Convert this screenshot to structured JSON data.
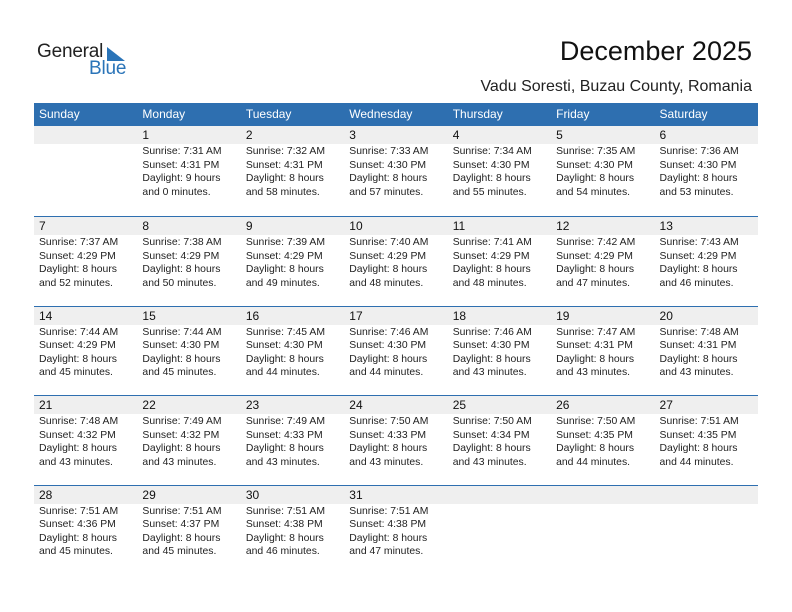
{
  "logo": {
    "general": "General",
    "blue": "Blue"
  },
  "header": {
    "title": "December 2025",
    "location": "Vadu Soresti, Buzau County, Romania"
  },
  "colors": {
    "accent": "#2e6fb0",
    "date_row_bg": "#efefef"
  },
  "weekdays": [
    "Sunday",
    "Monday",
    "Tuesday",
    "Wednesday",
    "Thursday",
    "Friday",
    "Saturday"
  ],
  "weeks": [
    [
      {
        "day": "",
        "sunrise": "",
        "sunset": "",
        "daylight1": "",
        "daylight2": ""
      },
      {
        "day": "1",
        "sunrise": "Sunrise: 7:31 AM",
        "sunset": "Sunset: 4:31 PM",
        "daylight1": "Daylight: 9 hours",
        "daylight2": "and 0 minutes."
      },
      {
        "day": "2",
        "sunrise": "Sunrise: 7:32 AM",
        "sunset": "Sunset: 4:31 PM",
        "daylight1": "Daylight: 8 hours",
        "daylight2": "and 58 minutes."
      },
      {
        "day": "3",
        "sunrise": "Sunrise: 7:33 AM",
        "sunset": "Sunset: 4:30 PM",
        "daylight1": "Daylight: 8 hours",
        "daylight2": "and 57 minutes."
      },
      {
        "day": "4",
        "sunrise": "Sunrise: 7:34 AM",
        "sunset": "Sunset: 4:30 PM",
        "daylight1": "Daylight: 8 hours",
        "daylight2": "and 55 minutes."
      },
      {
        "day": "5",
        "sunrise": "Sunrise: 7:35 AM",
        "sunset": "Sunset: 4:30 PM",
        "daylight1": "Daylight: 8 hours",
        "daylight2": "and 54 minutes."
      },
      {
        "day": "6",
        "sunrise": "Sunrise: 7:36 AM",
        "sunset": "Sunset: 4:30 PM",
        "daylight1": "Daylight: 8 hours",
        "daylight2": "and 53 minutes."
      }
    ],
    [
      {
        "day": "7",
        "sunrise": "Sunrise: 7:37 AM",
        "sunset": "Sunset: 4:29 PM",
        "daylight1": "Daylight: 8 hours",
        "daylight2": "and 52 minutes."
      },
      {
        "day": "8",
        "sunrise": "Sunrise: 7:38 AM",
        "sunset": "Sunset: 4:29 PM",
        "daylight1": "Daylight: 8 hours",
        "daylight2": "and 50 minutes."
      },
      {
        "day": "9",
        "sunrise": "Sunrise: 7:39 AM",
        "sunset": "Sunset: 4:29 PM",
        "daylight1": "Daylight: 8 hours",
        "daylight2": "and 49 minutes."
      },
      {
        "day": "10",
        "sunrise": "Sunrise: 7:40 AM",
        "sunset": "Sunset: 4:29 PM",
        "daylight1": "Daylight: 8 hours",
        "daylight2": "and 48 minutes."
      },
      {
        "day": "11",
        "sunrise": "Sunrise: 7:41 AM",
        "sunset": "Sunset: 4:29 PM",
        "daylight1": "Daylight: 8 hours",
        "daylight2": "and 48 minutes."
      },
      {
        "day": "12",
        "sunrise": "Sunrise: 7:42 AM",
        "sunset": "Sunset: 4:29 PM",
        "daylight1": "Daylight: 8 hours",
        "daylight2": "and 47 minutes."
      },
      {
        "day": "13",
        "sunrise": "Sunrise: 7:43 AM",
        "sunset": "Sunset: 4:29 PM",
        "daylight1": "Daylight: 8 hours",
        "daylight2": "and 46 minutes."
      }
    ],
    [
      {
        "day": "14",
        "sunrise": "Sunrise: 7:44 AM",
        "sunset": "Sunset: 4:29 PM",
        "daylight1": "Daylight: 8 hours",
        "daylight2": "and 45 minutes."
      },
      {
        "day": "15",
        "sunrise": "Sunrise: 7:44 AM",
        "sunset": "Sunset: 4:30 PM",
        "daylight1": "Daylight: 8 hours",
        "daylight2": "and 45 minutes."
      },
      {
        "day": "16",
        "sunrise": "Sunrise: 7:45 AM",
        "sunset": "Sunset: 4:30 PM",
        "daylight1": "Daylight: 8 hours",
        "daylight2": "and 44 minutes."
      },
      {
        "day": "17",
        "sunrise": "Sunrise: 7:46 AM",
        "sunset": "Sunset: 4:30 PM",
        "daylight1": "Daylight: 8 hours",
        "daylight2": "and 44 minutes."
      },
      {
        "day": "18",
        "sunrise": "Sunrise: 7:46 AM",
        "sunset": "Sunset: 4:30 PM",
        "daylight1": "Daylight: 8 hours",
        "daylight2": "and 43 minutes."
      },
      {
        "day": "19",
        "sunrise": "Sunrise: 7:47 AM",
        "sunset": "Sunset: 4:31 PM",
        "daylight1": "Daylight: 8 hours",
        "daylight2": "and 43 minutes."
      },
      {
        "day": "20",
        "sunrise": "Sunrise: 7:48 AM",
        "sunset": "Sunset: 4:31 PM",
        "daylight1": "Daylight: 8 hours",
        "daylight2": "and 43 minutes."
      }
    ],
    [
      {
        "day": "21",
        "sunrise": "Sunrise: 7:48 AM",
        "sunset": "Sunset: 4:32 PM",
        "daylight1": "Daylight: 8 hours",
        "daylight2": "and 43 minutes."
      },
      {
        "day": "22",
        "sunrise": "Sunrise: 7:49 AM",
        "sunset": "Sunset: 4:32 PM",
        "daylight1": "Daylight: 8 hours",
        "daylight2": "and 43 minutes."
      },
      {
        "day": "23",
        "sunrise": "Sunrise: 7:49 AM",
        "sunset": "Sunset: 4:33 PM",
        "daylight1": "Daylight: 8 hours",
        "daylight2": "and 43 minutes."
      },
      {
        "day": "24",
        "sunrise": "Sunrise: 7:50 AM",
        "sunset": "Sunset: 4:33 PM",
        "daylight1": "Daylight: 8 hours",
        "daylight2": "and 43 minutes."
      },
      {
        "day": "25",
        "sunrise": "Sunrise: 7:50 AM",
        "sunset": "Sunset: 4:34 PM",
        "daylight1": "Daylight: 8 hours",
        "daylight2": "and 43 minutes."
      },
      {
        "day": "26",
        "sunrise": "Sunrise: 7:50 AM",
        "sunset": "Sunset: 4:35 PM",
        "daylight1": "Daylight: 8 hours",
        "daylight2": "and 44 minutes."
      },
      {
        "day": "27",
        "sunrise": "Sunrise: 7:51 AM",
        "sunset": "Sunset: 4:35 PM",
        "daylight1": "Daylight: 8 hours",
        "daylight2": "and 44 minutes."
      }
    ],
    [
      {
        "day": "28",
        "sunrise": "Sunrise: 7:51 AM",
        "sunset": "Sunset: 4:36 PM",
        "daylight1": "Daylight: 8 hours",
        "daylight2": "and 45 minutes."
      },
      {
        "day": "29",
        "sunrise": "Sunrise: 7:51 AM",
        "sunset": "Sunset: 4:37 PM",
        "daylight1": "Daylight: 8 hours",
        "daylight2": "and 45 minutes."
      },
      {
        "day": "30",
        "sunrise": "Sunrise: 7:51 AM",
        "sunset": "Sunset: 4:38 PM",
        "daylight1": "Daylight: 8 hours",
        "daylight2": "and 46 minutes."
      },
      {
        "day": "31",
        "sunrise": "Sunrise: 7:51 AM",
        "sunset": "Sunset: 4:38 PM",
        "daylight1": "Daylight: 8 hours",
        "daylight2": "and 47 minutes."
      },
      {
        "day": "",
        "sunrise": "",
        "sunset": "",
        "daylight1": "",
        "daylight2": ""
      },
      {
        "day": "",
        "sunrise": "",
        "sunset": "",
        "daylight1": "",
        "daylight2": ""
      },
      {
        "day": "",
        "sunrise": "",
        "sunset": "",
        "daylight1": "",
        "daylight2": ""
      }
    ]
  ]
}
